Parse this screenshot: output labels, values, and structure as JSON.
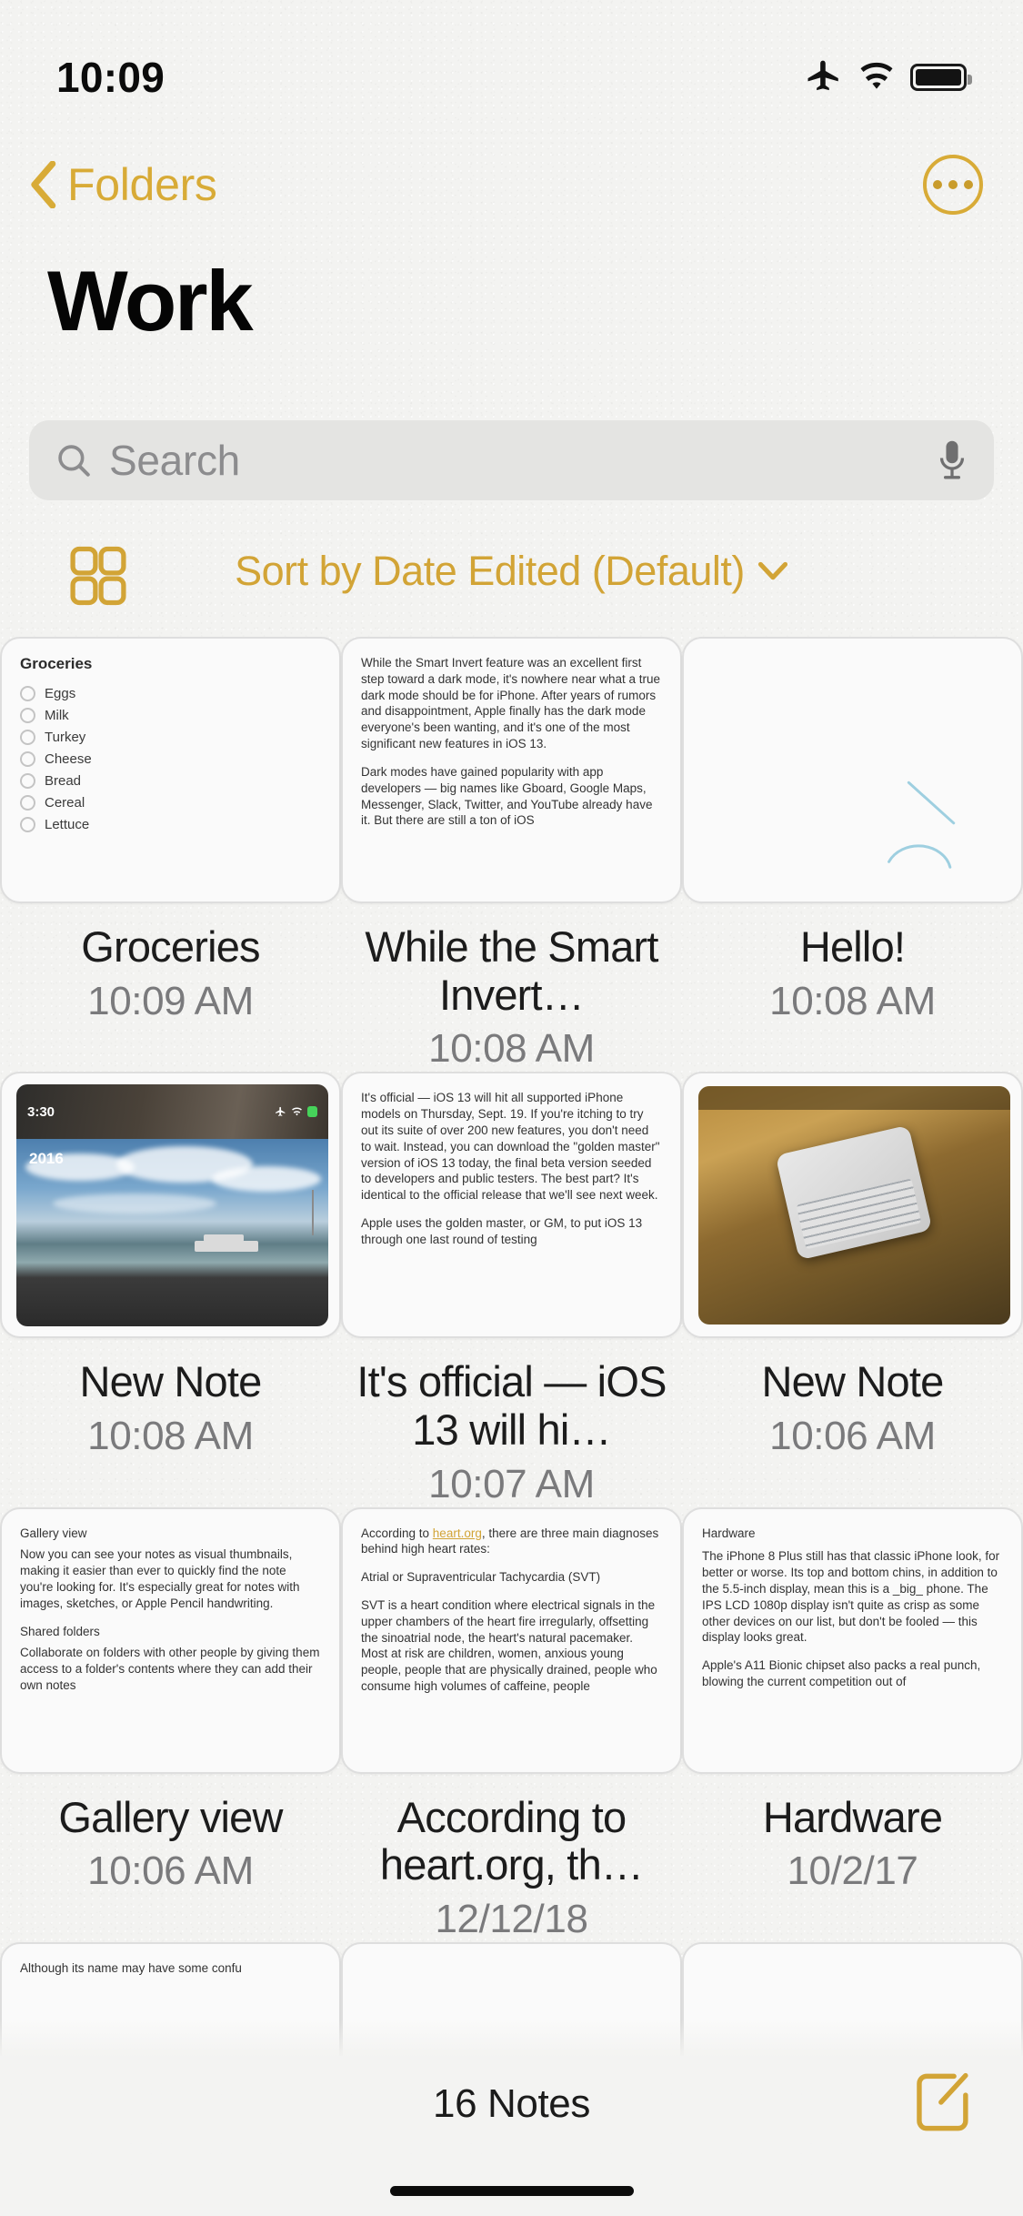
{
  "status_bar": {
    "time": "10:09",
    "icons": [
      "airplane-mode-icon",
      "wifi-icon",
      "battery-icon"
    ]
  },
  "nav": {
    "back_label": "Folders",
    "back_icon": "chevron-left-icon",
    "more_icon": "ellipsis-circle-icon"
  },
  "header": {
    "title": "Work"
  },
  "search": {
    "placeholder": "Search",
    "value": "",
    "search_icon": "magnifying-glass-icon",
    "mic_icon": "microphone-icon"
  },
  "toolbar": {
    "gallery_icon": "gallery-grid-icon",
    "sort_label": "Sort by Date Edited (Default)",
    "sort_chevron": "chevron-down-icon"
  },
  "colors": {
    "accent": "#d8ab37",
    "sort_accent": "#d2a436",
    "background": "#f3f3f1",
    "thumb_background": "#fafafa",
    "thumb_border": "#dedede",
    "secondary_text": "#7a7a7c"
  },
  "notes": [
    {
      "title": "Groceries",
      "date": "10:09 AM",
      "type": "checklist",
      "checklist_title": "Groceries",
      "items": [
        "Eggs",
        "Milk",
        "Turkey",
        "Cheese",
        "Bread",
        "Cereal",
        "Lettuce"
      ]
    },
    {
      "title": "While the Smart Invert…",
      "date": "10:08 AM",
      "type": "text",
      "paragraphs": [
        "While the Smart Invert feature was an excellent first step toward a dark mode, it's nowhere near what a true dark mode should be for iPhone. After years of rumors and disappointment, Apple finally has the dark mode everyone's been wanting, and it's one of the most significant new features in iOS 13.",
        "Dark modes have gained popularity with app developers — big names like Gboard, Google Maps, Messenger, Slack, Twitter, and YouTube already have it. But there are still a ton of iOS"
      ]
    },
    {
      "title": "Hello!",
      "date": "10:08 AM",
      "type": "drawing"
    },
    {
      "title": "New Note",
      "date": "10:08 AM",
      "type": "photo-screenshot",
      "screenshot_time": "3:30",
      "photo_year": "2016"
    },
    {
      "title": "It's official — iOS 13 will hi…",
      "date": "10:07 AM",
      "type": "text",
      "paragraphs": [
        "It's official — iOS 13 will hit all supported iPhone models on Thursday, Sept. 19. If you're itching to try out its suite of over 200 new features, you don't need to wait. Instead, you can download the \"golden master\" version of iOS 13 today, the final beta version seeded to developers and public testers. The best part? It's identical to the official release that we'll see next week.",
        "Apple uses the golden master, or GM, to put iOS 13 through one last round of testing"
      ]
    },
    {
      "title": "New Note",
      "date": "10:06 AM",
      "type": "photo-desk"
    },
    {
      "title": "Gallery view",
      "date": "10:06 AM",
      "type": "text",
      "paragraphs": [
        "Gallery view",
        "Now you can see your notes as visual thumbnails, making it easier than ever to quickly find the note you're looking for. It's especially great for notes with images, sketches, or Apple Pencil handwriting.",
        "Shared folders",
        "Collaborate on folders with other people by giving them access to a folder's contents where they can add their own notes"
      ]
    },
    {
      "title": "According to heart.org, th…",
      "date": "12/12/18",
      "type": "text-link",
      "lead_before": "According to ",
      "lead_link": "heart.org",
      "lead_after": ", there are three main diagnoses behind high heart rates:",
      "paragraphs": [
        "Atrial or Supraventricular Tachycardia (SVT)",
        "SVT is a heart condition where electrical signals in the upper chambers of the heart fire irregularly, offsetting the sinoatrial node, the heart's natural pacemaker. Most at risk are children, women, anxious young people, people that are physically drained, people who consume high volumes of caffeine, people"
      ]
    },
    {
      "title": "Hardware",
      "date": "10/2/17",
      "type": "text",
      "paragraphs": [
        "Hardware",
        "The iPhone 8 Plus still has that classic iPhone look, for better or worse. Its top and bottom chins, in addition to the 5.5-inch display, mean this is a _big_ phone. The IPS LCD 1080p display isn't quite as crisp as some other devices on our list, but don't be fooled — this display looks great.",
        "Apple's A11 Bionic chipset also packs a real punch, blowing the current competition out of"
      ]
    },
    {
      "title": "",
      "date": "",
      "type": "text-partial",
      "paragraphs": [
        "Although its name may have some confu"
      ]
    },
    {
      "title": "",
      "date": "",
      "type": "empty"
    },
    {
      "title": "",
      "date": "",
      "type": "empty"
    }
  ],
  "bottom_bar": {
    "count_label": "16 Notes",
    "compose_icon": "compose-note-icon"
  }
}
